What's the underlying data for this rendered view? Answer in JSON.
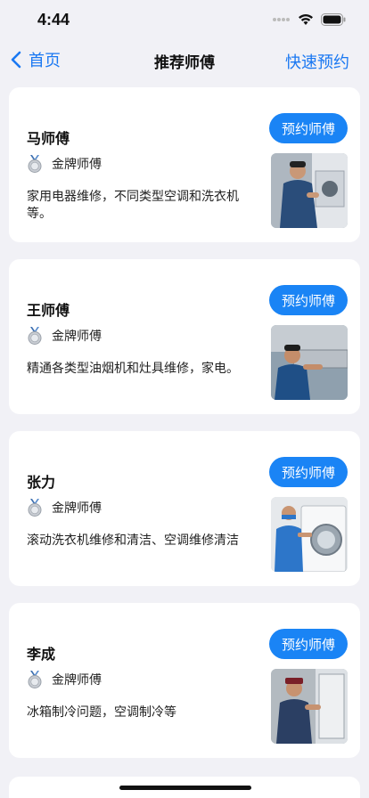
{
  "status_bar": {
    "time": "4:44"
  },
  "nav": {
    "back_label": "首页",
    "title": "推荐师傅",
    "action_label": "快速预约"
  },
  "masters": [
    {
      "name": "马师傅",
      "badge": "金牌师傅",
      "description": "家用电器维修，不同类型空调和洗衣机等。",
      "book_label": "预约师傅",
      "photo_icon": "technician-air-conditioner-photo"
    },
    {
      "name": "王师傅",
      "badge": "金牌师傅",
      "description": "精通各类型油烟机和灶具维修，家电。",
      "book_label": "预约师傅",
      "photo_icon": "technician-range-hood-photo"
    },
    {
      "name": "张力",
      "badge": "金牌师傅",
      "description": "滚动洗衣机维修和清洁、空调维修清洁",
      "book_label": "预约师傅",
      "photo_icon": "technician-washing-machine-photo"
    },
    {
      "name": "李成",
      "badge": "金牌师傅",
      "description": "冰箱制冷问题，空调制冷等",
      "book_label": "预约师傅",
      "photo_icon": "technician-refrigerator-photo"
    }
  ],
  "colors": {
    "accent": "#1a84f5",
    "background": "#f1f1f6",
    "card": "#ffffff"
  }
}
